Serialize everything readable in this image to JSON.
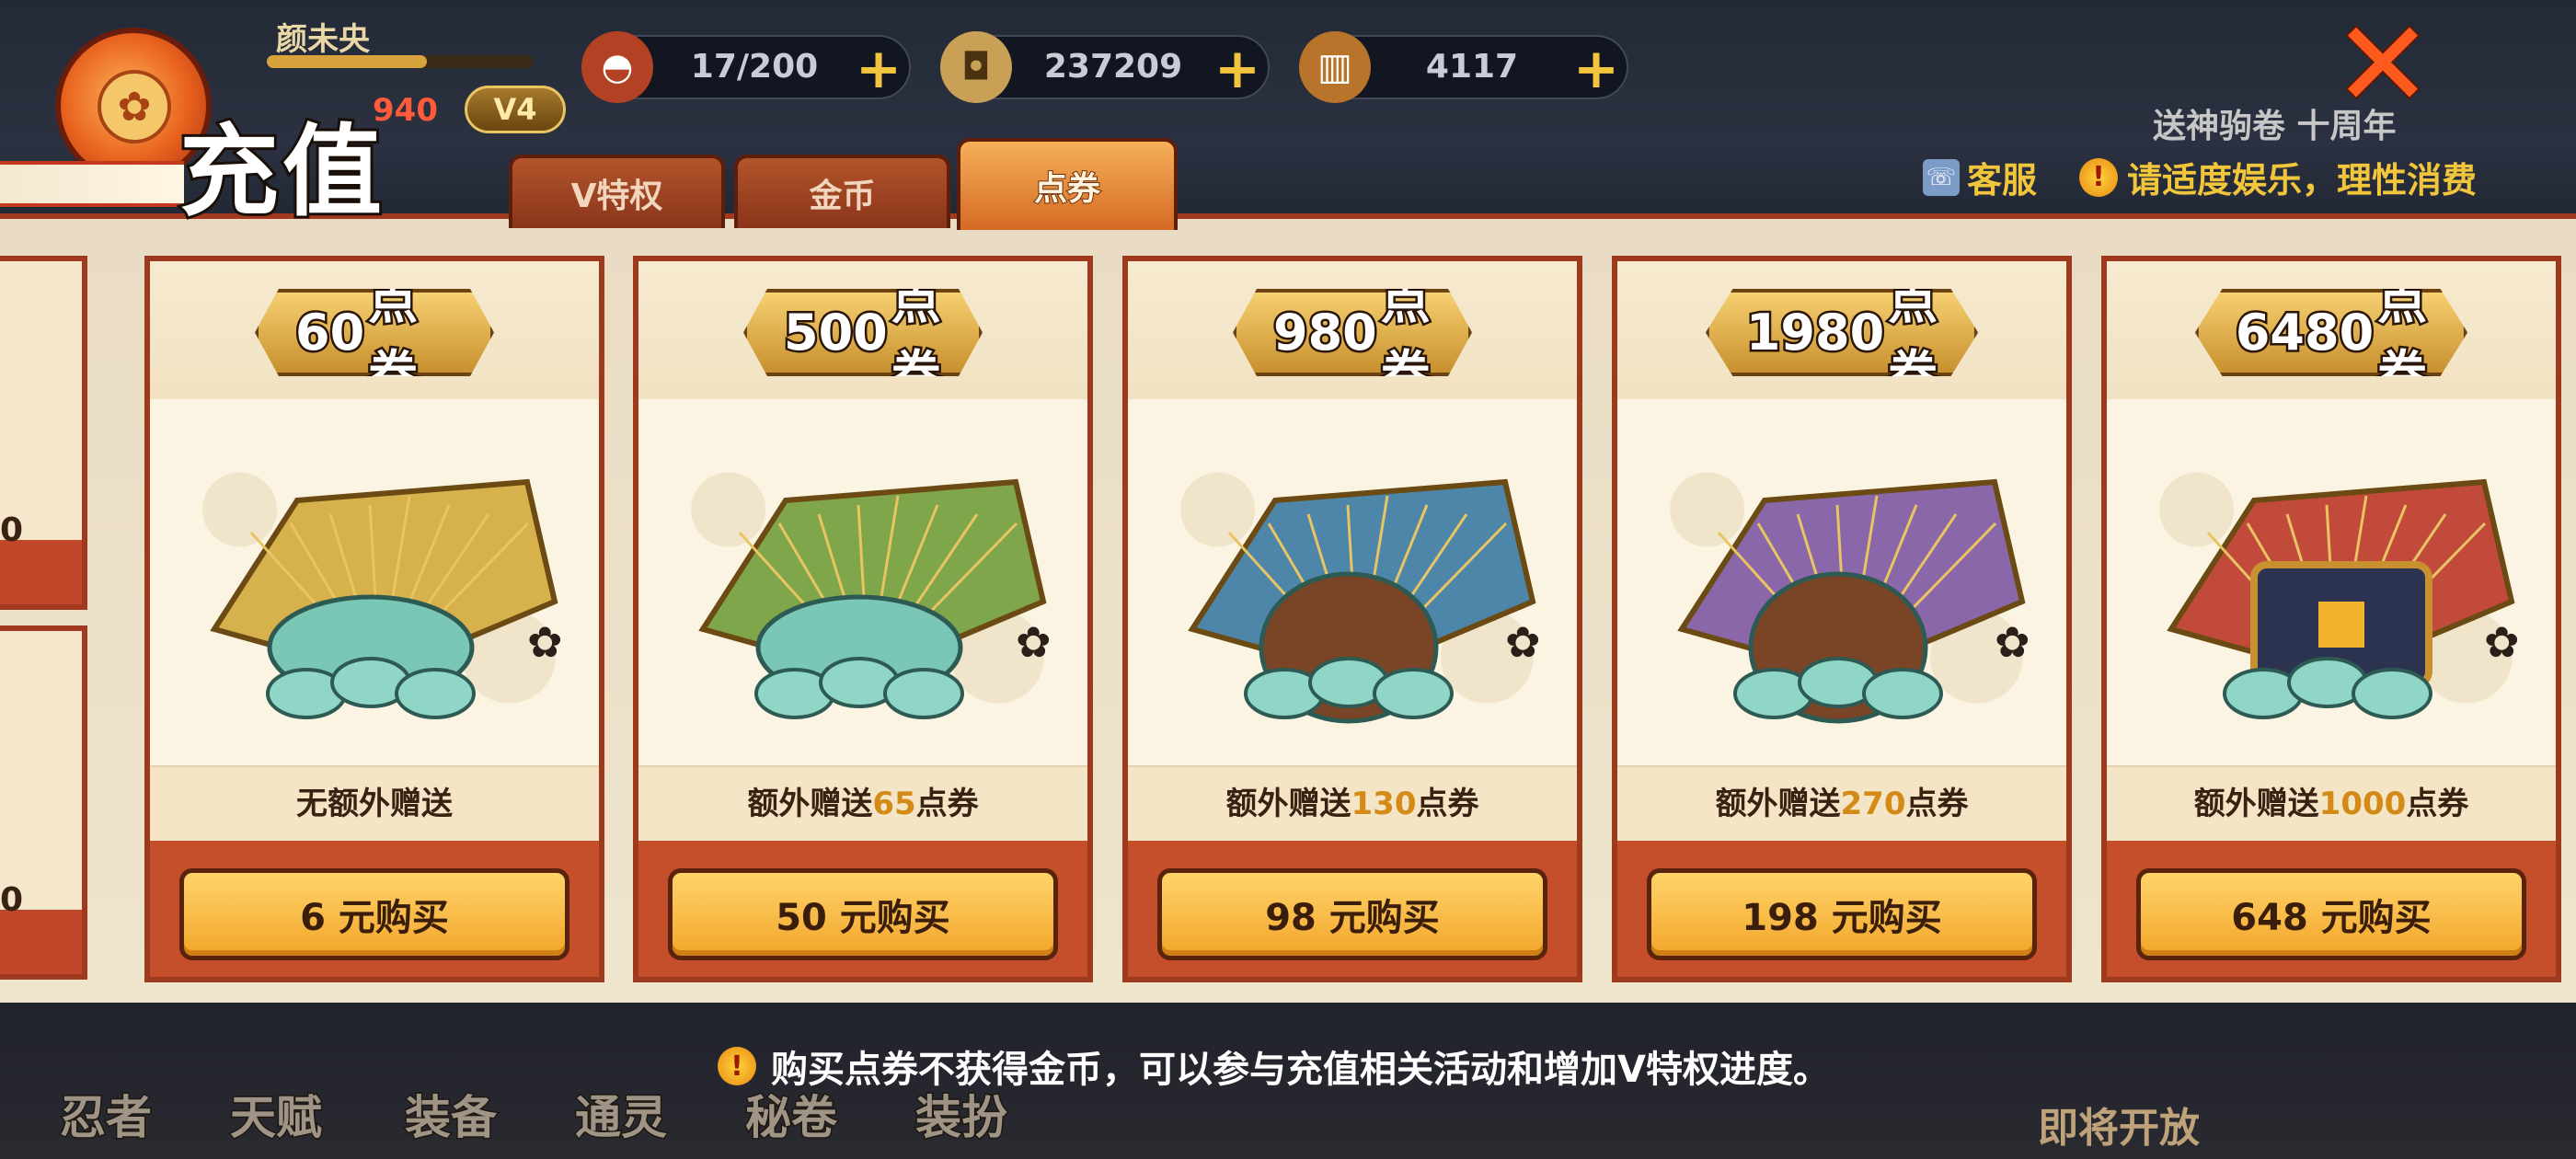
{
  "header": {
    "title": "充值",
    "player_name": "颜未央",
    "player_power": "940",
    "vip_level": "V4",
    "promo_text": "送神驹卷 十周年"
  },
  "resources": [
    {
      "icon": "ramen-bowl-icon",
      "value": "17/200"
    },
    {
      "icon": "copper-coin-icon",
      "value": "237209"
    },
    {
      "icon": "scroll-roll-icon",
      "value": "4117"
    }
  ],
  "tabs": [
    {
      "label": "V特权",
      "active": false
    },
    {
      "label": "金币",
      "active": false
    },
    {
      "label": "点券",
      "active": true
    }
  ],
  "service": {
    "label": "客服"
  },
  "notice": {
    "label": "请适度娱乐，理性消费"
  },
  "left_partial_digits": [
    "0",
    "0"
  ],
  "products": [
    {
      "amount": "60",
      "unit": "点券",
      "bonus_prefix": "无额外赠送",
      "bonus_value": "",
      "bonus_suffix": "",
      "price_button": "6 元购买",
      "fan_color": "#d6b14c",
      "art": "fan-with-tokens"
    },
    {
      "amount": "500",
      "unit": "点券",
      "bonus_prefix": "额外赠送",
      "bonus_value": "65",
      "bonus_suffix": "点券",
      "price_button": "50 元购买",
      "fan_color": "#7fa64a",
      "art": "fan-with-token-pile"
    },
    {
      "amount": "980",
      "unit": "点券",
      "bonus_prefix": "额外赠送",
      "bonus_value": "130",
      "bonus_suffix": "点券",
      "price_button": "98 元购买",
      "fan_color": "#4d86a8",
      "art": "fan-with-pouch"
    },
    {
      "amount": "1980",
      "unit": "点券",
      "bonus_prefix": "额外赠送",
      "bonus_value": "270",
      "bonus_suffix": "点券",
      "price_button": "198 元购买",
      "fan_color": "#8a67a8",
      "art": "fan-with-open-pouch"
    },
    {
      "amount": "6480",
      "unit": "点券",
      "bonus_prefix": "额外赠送",
      "bonus_value": "1000",
      "bonus_suffix": "点券",
      "price_button": "648 元购买",
      "fan_color": "#c24a3a",
      "art": "fan-with-treasure-chest"
    }
  ],
  "footer": {
    "note": "购买点券不获得金币，可以参与充值相关活动和增加V特权进度。",
    "nav": [
      "忍者",
      "天赋",
      "装备",
      "通灵",
      "秘卷",
      "装扮"
    ],
    "coming_soon": "即将开放"
  },
  "colors": {
    "accent_gold": "#f1c63c",
    "frame_red": "#9d3a1d",
    "bonus_highlight": "#d38a17",
    "button_gold": "#ffd36a"
  }
}
